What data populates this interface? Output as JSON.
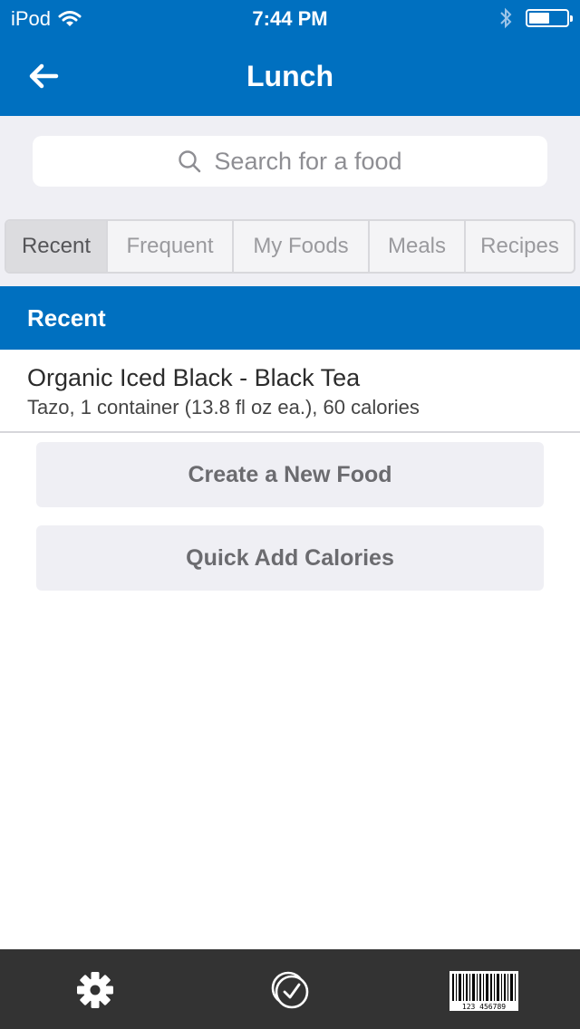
{
  "status_bar": {
    "carrier": "iPod",
    "time": "7:44 PM",
    "battery_level": 0.55
  },
  "nav": {
    "title": "Lunch",
    "back_icon": "arrow-left-icon"
  },
  "search": {
    "placeholder": "Search for a food",
    "icon": "search-icon"
  },
  "tabs": [
    {
      "label": "Recent",
      "active": true
    },
    {
      "label": "Frequent",
      "active": false
    },
    {
      "label": "My Foods",
      "active": false
    },
    {
      "label": "Meals",
      "active": false
    },
    {
      "label": "Recipes",
      "active": false
    }
  ],
  "section": {
    "title": "Recent"
  },
  "foods": [
    {
      "name": "Organic Iced Black - Black Tea",
      "description": "Tazo, 1 container (13.8 fl oz ea.), 60 calories"
    }
  ],
  "actions": {
    "create_label": "Create a New Food",
    "quick_add_label": "Quick Add Calories"
  },
  "bottom_bar": {
    "settings_icon": "gear-icon",
    "check_icon": "check-circle-icon",
    "barcode_icon": "barcode-icon",
    "barcode_digits": "123 456789"
  },
  "colors": {
    "brand": "#0070c0",
    "bottom_bar": "#333333",
    "panel": "#efeff4"
  }
}
